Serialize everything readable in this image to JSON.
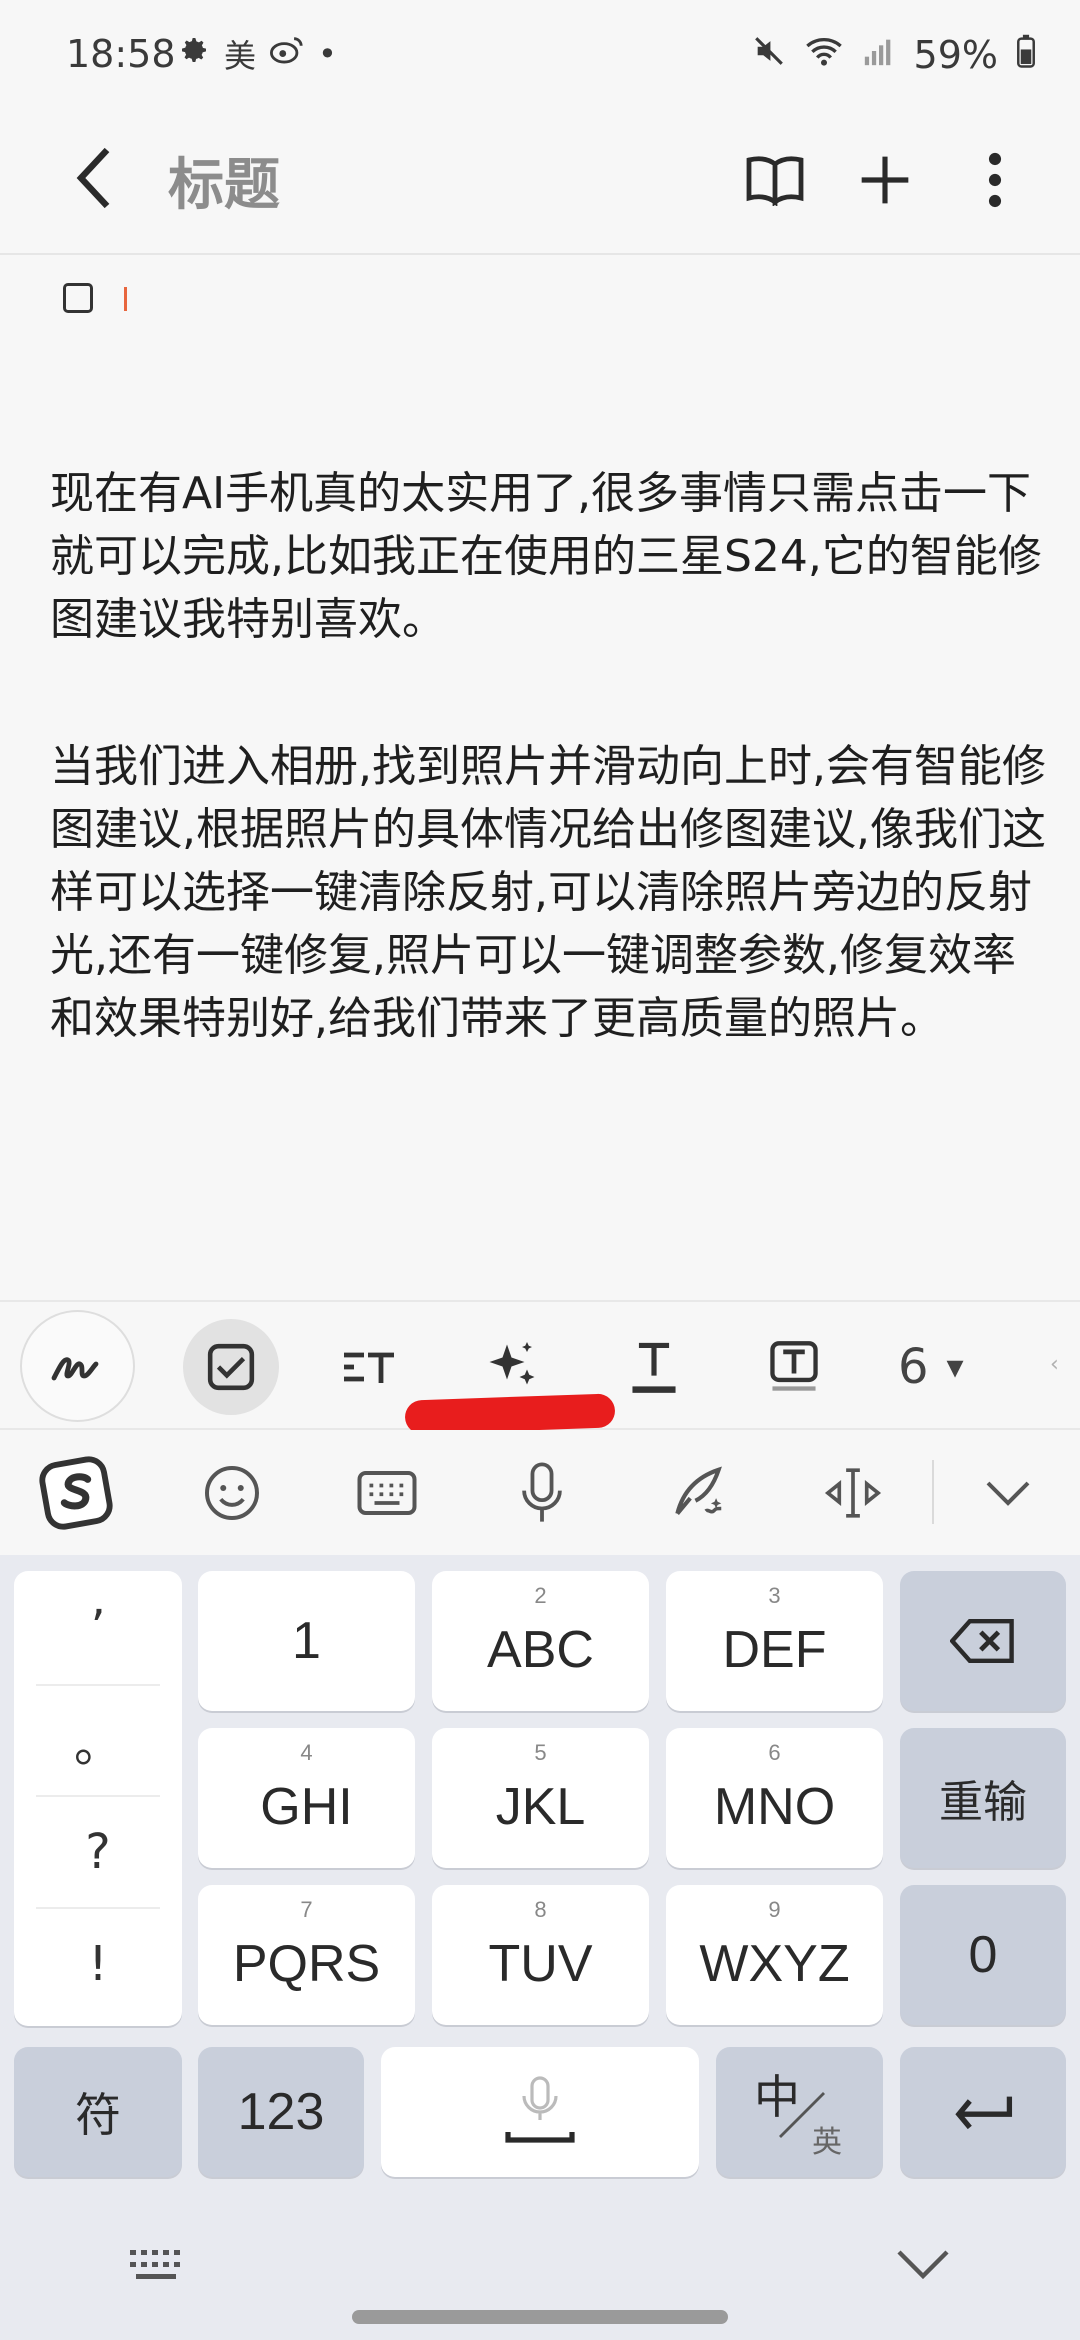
{
  "status_bar": {
    "time": "18:58",
    "app_icons": [
      "gear-icon",
      "meituan-icon",
      "weibo-icon"
    ],
    "meituan_glyph": "美",
    "dot": "•",
    "battery": "59%"
  },
  "app_bar": {
    "title": "标题"
  },
  "content": {
    "paragraph1": "现在有AI手机真的太实用了,很多事情只需点击一下就可以完成,比如我正在使用的三星S24,它的智能修图建议我特别喜欢。",
    "paragraph2": "当我们进入相册,找到照片并滑动向上时,会有智能修图建议,根据照片的具体情况给出修图建议,像我们这样可以选择一键清除反射,可以清除照片旁边的反射光,还有一键修复,照片可以一键调整参数,修复效率和效果特别好,给我们带来了更高质量的照片。"
  },
  "toolbar": {
    "font_size": "6",
    "dropdown": "▾"
  },
  "keyboard": {
    "punctuation": [
      "’",
      "。",
      "?",
      "!"
    ],
    "keys": {
      "k1": "1",
      "k2_num": "2",
      "k2": "ABC",
      "k3_num": "3",
      "k3": "DEF",
      "k4_num": "4",
      "k4": "GHI",
      "k5_num": "5",
      "k5": "JKL",
      "k6_num": "6",
      "k6": "MNO",
      "k7_num": "7",
      "k7": "PQRS",
      "k8_num": "8",
      "k8": "TUV",
      "k9_num": "9",
      "k9": "WXYZ",
      "reenter": "重输",
      "zero": "0",
      "symbols": "符",
      "num123": "123",
      "lang_main": "中",
      "lang_sub": "英"
    }
  },
  "colors": {
    "accent_cursor": "#e8663e",
    "annotation_red": "#e81d1d",
    "title_gray": "#8c8c8c"
  }
}
